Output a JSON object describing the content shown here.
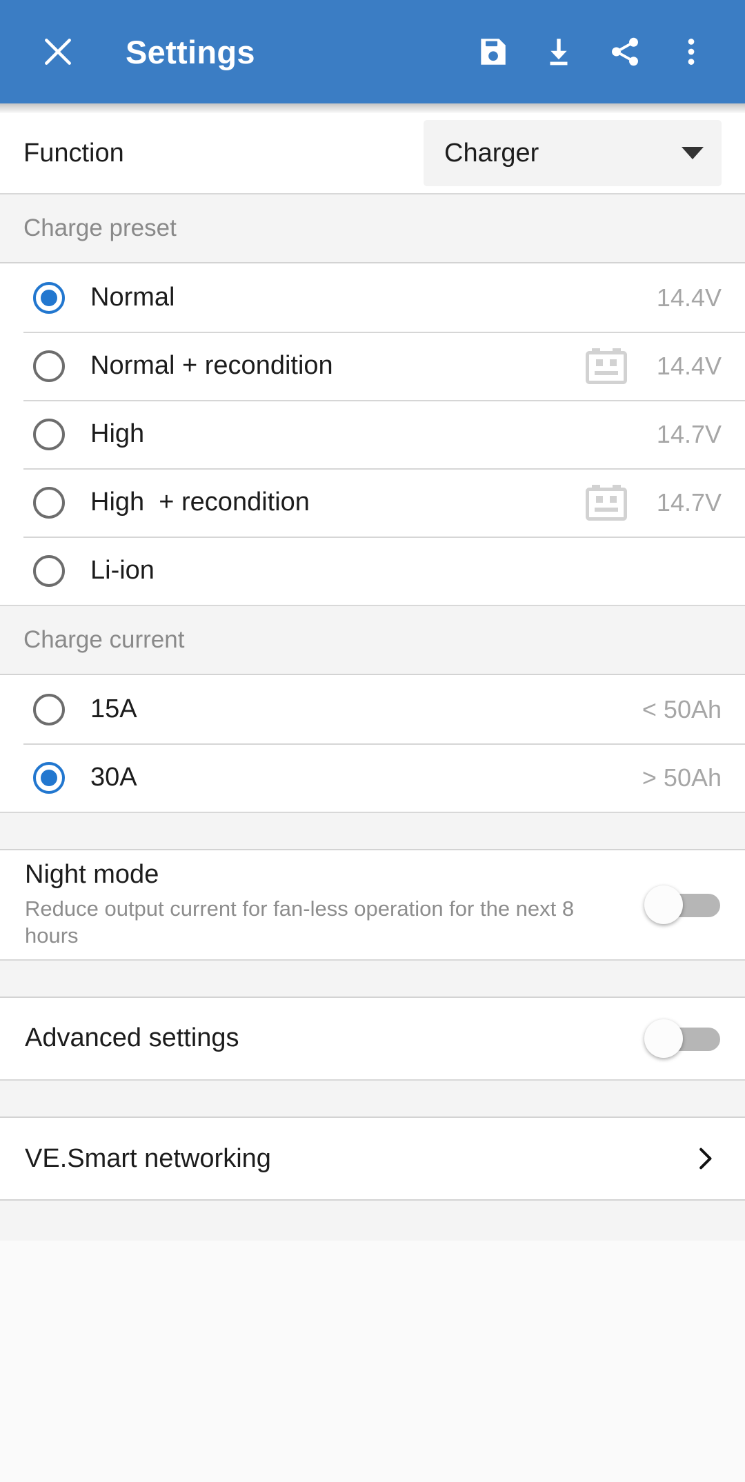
{
  "appbar": {
    "close_label": "close-icon",
    "title": "Settings",
    "save_label": "save-icon",
    "download_label": "download-icon",
    "share_label": "share-icon",
    "overflow_label": "more-vert-icon",
    "background_color": "#3b7dc4"
  },
  "function_row": {
    "label": "Function",
    "selected": "Charger"
  },
  "charge_preset": {
    "header": "Charge preset",
    "options": [
      {
        "label": "Normal",
        "value": "14.4V",
        "selected": true,
        "battery_icon": false
      },
      {
        "label": "Normal + recondition",
        "value": "14.4V",
        "selected": false,
        "battery_icon": true
      },
      {
        "label": "High",
        "value": "14.7V",
        "selected": false,
        "battery_icon": false
      },
      {
        "label": "High  + recondition",
        "value": "14.7V",
        "selected": false,
        "battery_icon": true
      },
      {
        "label": "Li-ion",
        "value": "",
        "selected": false,
        "battery_icon": false
      }
    ]
  },
  "charge_current": {
    "header": "Charge current",
    "options": [
      {
        "label": "15A",
        "value": "< 50Ah",
        "selected": false
      },
      {
        "label": "30A",
        "value": "> 50Ah",
        "selected": true
      }
    ]
  },
  "night_mode": {
    "title": "Night mode",
    "subtitle": "Reduce output current for fan-less operation for the next 8 hours",
    "enabled": false
  },
  "advanced_settings": {
    "title": "Advanced settings",
    "enabled": false
  },
  "ve_smart": {
    "title": "VE.Smart networking",
    "chevron": "chevron-right-icon"
  },
  "colors": {
    "accent": "#2277cf",
    "appbar": "#3b7dc4",
    "section_bg": "#f4f4f4",
    "muted_text": "#a6a6a6"
  }
}
